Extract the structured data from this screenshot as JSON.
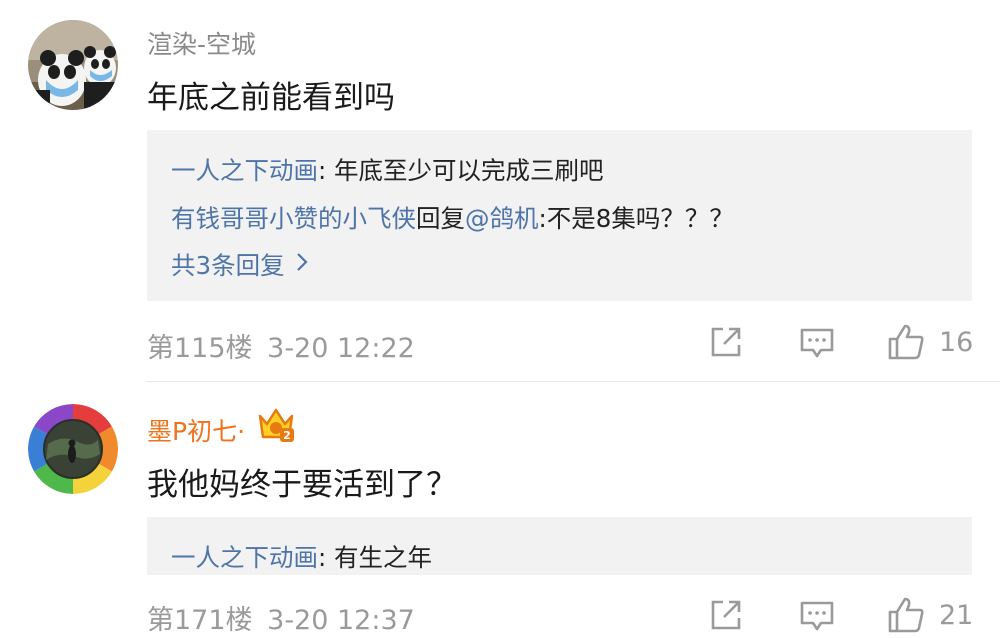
{
  "comments": [
    {
      "username": "渲染-空城",
      "text": "年底之前能看到吗",
      "replies": [
        {
          "author": "一人之下动画",
          "sep": ": ",
          "text": "年底至少可以完成三刷吧"
        },
        {
          "author": "有钱哥哥小赞的小飞侠",
          "mid": "回复",
          "mention": "@鸽机",
          "sep": ":",
          "text": "不是8集吗？？？"
        }
      ],
      "more_replies": "共3条回复",
      "floor": "第115楼",
      "time": "3-20 12:22",
      "likes": "16"
    },
    {
      "username": "墨P初七·",
      "badge_text": "2",
      "text": "我他妈终于要活到了？",
      "replies": [
        {
          "author": "一人之下动画",
          "sep": ": ",
          "text": "有生之年"
        }
      ],
      "floor": "第171楼",
      "time": "3-20 12:37",
      "likes": "21"
    }
  ],
  "colors": {
    "link": "#4e74a8",
    "vip_name": "#f0731c",
    "reply_bg": "#f2f2f2",
    "meta": "#9a9a9a"
  },
  "icons": [
    "share-icon",
    "comment-icon",
    "like-icon",
    "vip-crown-badge"
  ]
}
